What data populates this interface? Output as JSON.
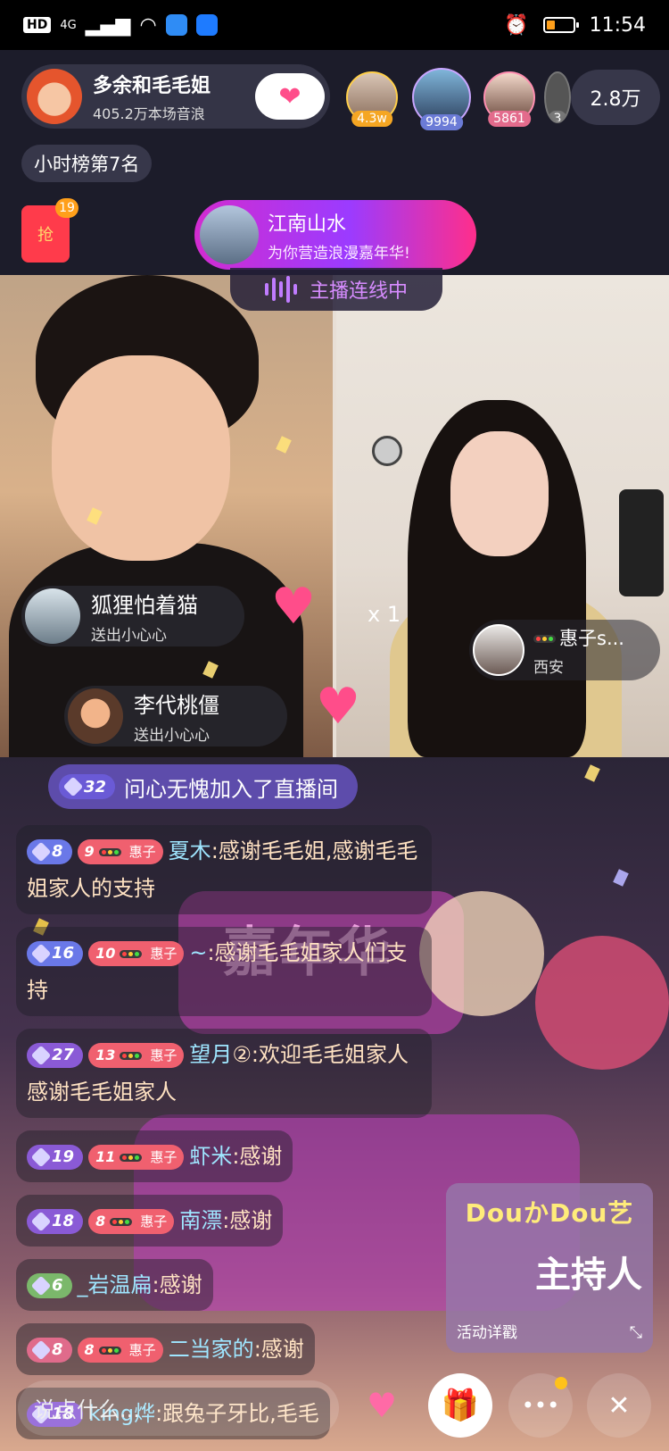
{
  "status_bar": {
    "network_chip": "HD",
    "network_small": "4G",
    "time": "11:54"
  },
  "host": {
    "name": "多余和毛毛姐",
    "stats": "405.2万本场音浪",
    "follow_icon": "heart-wings-icon"
  },
  "top_viewers": [
    {
      "badge": "4.3w",
      "color": "#f5a623"
    },
    {
      "badge": "9994",
      "color": "#6b7bd6"
    },
    {
      "badge": "5861",
      "color": "#e36b8c"
    },
    {
      "badge": "3",
      "color": "#777777"
    }
  ],
  "viewer_count": "2.8万",
  "hourly_rank": "小时榜第7名",
  "red_packet": {
    "label": "抢",
    "count": "19"
  },
  "banner": {
    "title": "江南山水",
    "subtitle": "为你营造浪漫嘉年华!"
  },
  "live_link_label": "主播连线中",
  "gift_notices": [
    {
      "name": "狐狸怕着猫",
      "action": "送出小心心"
    },
    {
      "name": "李代桃僵",
      "action": "送出小心心"
    }
  ],
  "combo_label": "x 1",
  "guest": {
    "name": "惠子s...",
    "city": "西安"
  },
  "join_message": {
    "level": "32",
    "user": "问心无愧",
    "text": "加入了直播间"
  },
  "chat": [
    {
      "level": "8",
      "fan_level": "9",
      "fan_name": "惠子",
      "user": "夏木",
      "message": ":感谢毛毛姐,感谢毛毛姐家人的支持",
      "lvl_color": "#6a78e8"
    },
    {
      "level": "16",
      "fan_level": "10",
      "fan_name": "惠子",
      "user": "~",
      "message": ":感谢毛毛姐家人们支持",
      "lvl_color": "#6a78e8"
    },
    {
      "level": "27",
      "fan_level": "13",
      "fan_name": "惠子",
      "user": "望月",
      "message": "②:欢迎毛毛姐家人感谢毛毛姐家人",
      "lvl_color": "#8a5ad6"
    },
    {
      "level": "19",
      "fan_level": "11",
      "fan_name": "惠子",
      "user": "虾米",
      "message": ":感谢",
      "lvl_color": "#8a5ad6"
    },
    {
      "level": "18",
      "fan_level": "8",
      "fan_name": "惠子",
      "user": "南漂",
      "message": ":感谢",
      "lvl_color": "#8a5ad6"
    },
    {
      "level": "6",
      "fan_level": "",
      "fan_name": "",
      "user": "_岩温扁",
      "message": ":感谢",
      "lvl_color": "#7bb86b"
    },
    {
      "level": "8",
      "fan_level": "8",
      "fan_name": "惠子",
      "user": "二当家的",
      "message": ":感谢",
      "lvl_color": "#e06b8b"
    },
    {
      "level": "18",
      "fan_level": "",
      "fan_name": "",
      "user": "king烨",
      "message": ":跟兔子牙比,毛毛",
      "lvl_color": "#8a5ad6"
    }
  ],
  "activity": {
    "line1": "DouかDou艺",
    "line2": "主持人",
    "link": "活动详戳"
  },
  "bottom_bar": {
    "placeholder": "说点什么...",
    "gift_icon": "gift-box-icon",
    "more_label": "•••",
    "close_label": "✕"
  },
  "decoration_text": "嘉年华"
}
